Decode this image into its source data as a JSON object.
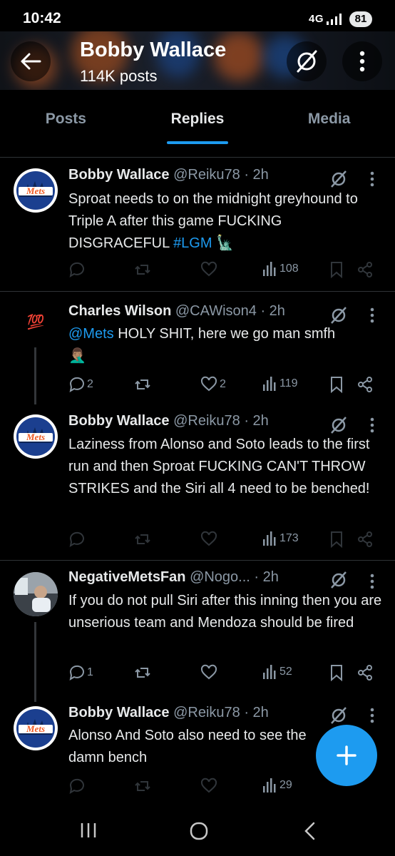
{
  "status_bar": {
    "time": "10:42",
    "network": "4G",
    "battery": "81"
  },
  "header": {
    "title": "Bobby Wallace",
    "subtitle": "114K posts"
  },
  "tabs": [
    {
      "label": "Posts"
    },
    {
      "label": "Replies"
    },
    {
      "label": "Media"
    }
  ],
  "posts": [
    {
      "name": "Bobby Wallace",
      "handle": "@Reiku78 · 2h",
      "text_main": "Sproat needs to on the midnight greyhound to Triple A after this game FUCKING DISGRACEFUL ",
      "hashtag": "#LGM",
      "emoji": "🗽",
      "replies": "",
      "reposts": "",
      "likes": "",
      "views": "108"
    },
    {
      "name": "Charles Wilson",
      "handle": "@CAWison4 · 2h",
      "mention": "@Mets",
      "text_main": " HOLY SHIT, here we go man smfh",
      "emoji": "🤦🏽‍♂️",
      "avatar_emoji": "💯",
      "replies": "2",
      "reposts": "",
      "likes": "2",
      "views": "119"
    },
    {
      "name": "Bobby Wallace",
      "handle": "@Reiku78 · 2h",
      "text_main": "Laziness from Alonso and Soto leads to the first run and then Sproat FUCKING CAN'T THROW STRIKES and the Siri all 4 need to be benched!",
      "replies": "",
      "reposts": "",
      "likes": "",
      "views": "173"
    },
    {
      "name": "NegativeMetsFan",
      "handle": "@Nogo... · 2h",
      "text_main": "If you do not pull Siri after this inning then you are unserious team and Mendoza should be fired",
      "replies": "1",
      "reposts": "",
      "likes": "",
      "views": "52"
    },
    {
      "name": "Bobby Wallace",
      "handle": "@Reiku78 · 2h",
      "text_main": "Alonso And Soto also need to see the damn bench",
      "replies": "",
      "reposts": "",
      "likes": "",
      "views": "29"
    }
  ],
  "avatar_logo_text": "Mets",
  "colors": {
    "accent": "#1d9bf0",
    "background": "#000000",
    "muted": "#8b98a5",
    "text": "#e7e9ea"
  }
}
